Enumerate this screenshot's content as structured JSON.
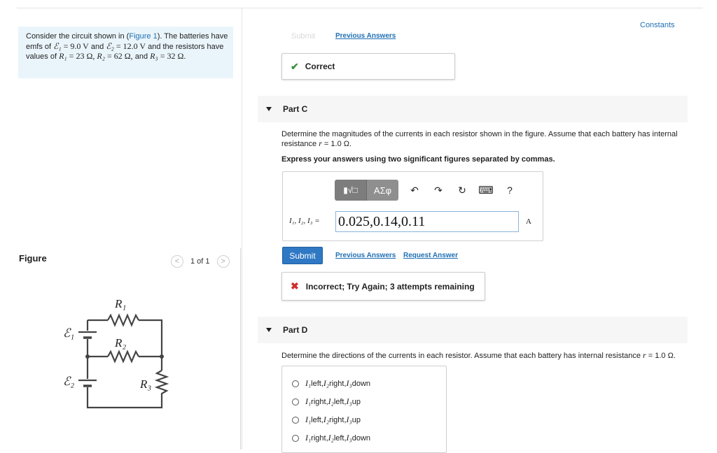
{
  "problem": {
    "text1": "Consider the circuit shown in (",
    "figure_link": "Figure 1",
    "text2": "). The batteries have emfs of ",
    "emf1_sym": "ℰ₁",
    "emf1_val": "= 9.0 V",
    "and1": " and ",
    "emf2_sym": "ℰ₂",
    "emf2_val": "= 12.0 V",
    "text3": " and the resistors have values of ",
    "r1_sym": "R₁",
    "r1_val": "= 23 Ω,",
    "r2_sym": "R₂",
    "r2_val": "= 62 Ω,",
    "and2": " and ",
    "r3_sym": "R₃",
    "r3_val": "= 32 Ω."
  },
  "figure": {
    "label": "Figure",
    "pager_text": "1 of 1",
    "prev_glyph": "<",
    "next_glyph": ">",
    "labels": {
      "r1": "R₁",
      "r2": "R₂",
      "r3": "R₃",
      "e1": "ℰ₁",
      "e2": "ℰ₂"
    }
  },
  "constants_link": "Constants",
  "part_b": {
    "submit_label": "Submit",
    "previous_answers": "Previous Answers",
    "feedback_icon": "✔",
    "feedback_text": "Correct",
    "feedback_color": "#3f8f3f"
  },
  "part_c": {
    "title": "Part C",
    "question": "Determine the magnitudes of the currents in each resistor shown in the figure. Assume that each battery has internal resistance ",
    "question_sym": "r",
    "question_val": " = 1.0 Ω.",
    "instruction": "Express your answers using two significant figures separated by commas.",
    "toolbar": {
      "templates_icon": "▮√□",
      "symbols": "ΑΣφ",
      "undo_icon": "↶",
      "redo_icon": "↷",
      "reset_icon": "↻",
      "keyboard_icon": "⌨",
      "help": "?"
    },
    "answer_label": "I₁, I₂, I₃ =",
    "answer_value": "0.025,0.14,0.11",
    "unit": "A",
    "submit_label": "Submit",
    "previous_answers": "Previous Answers",
    "request_answer": "Request Answer",
    "feedback_icon": "✖",
    "feedback_text": "Incorrect; Try Again; 3 attempts remaining",
    "feedback_color": "#d03030"
  },
  "part_d": {
    "title": "Part D",
    "question": "Determine the directions of the currents in each resistor. Assume that each battery has internal resistance ",
    "question_sym": "r",
    "question_val": " = 1.0 Ω.",
    "options": [
      {
        "i1": "I₁",
        "d1": " left, ",
        "i2": "I₂",
        "d2": " right, ",
        "i3": "I₃",
        "d3": " down"
      },
      {
        "i1": "I₁",
        "d1": " right, ",
        "i2": "I₂",
        "d2": " left, ",
        "i3": "I₃",
        "d3": " up"
      },
      {
        "i1": "I₁",
        "d1": " left, ",
        "i2": "I₂",
        "d2": " right, ",
        "i3": "I₃",
        "d3": " up"
      },
      {
        "i1": "I₁",
        "d1": "right, ",
        "i2": "I₂",
        "d2": " left, ",
        "i3": "I₃",
        "d3": " down"
      }
    ]
  }
}
